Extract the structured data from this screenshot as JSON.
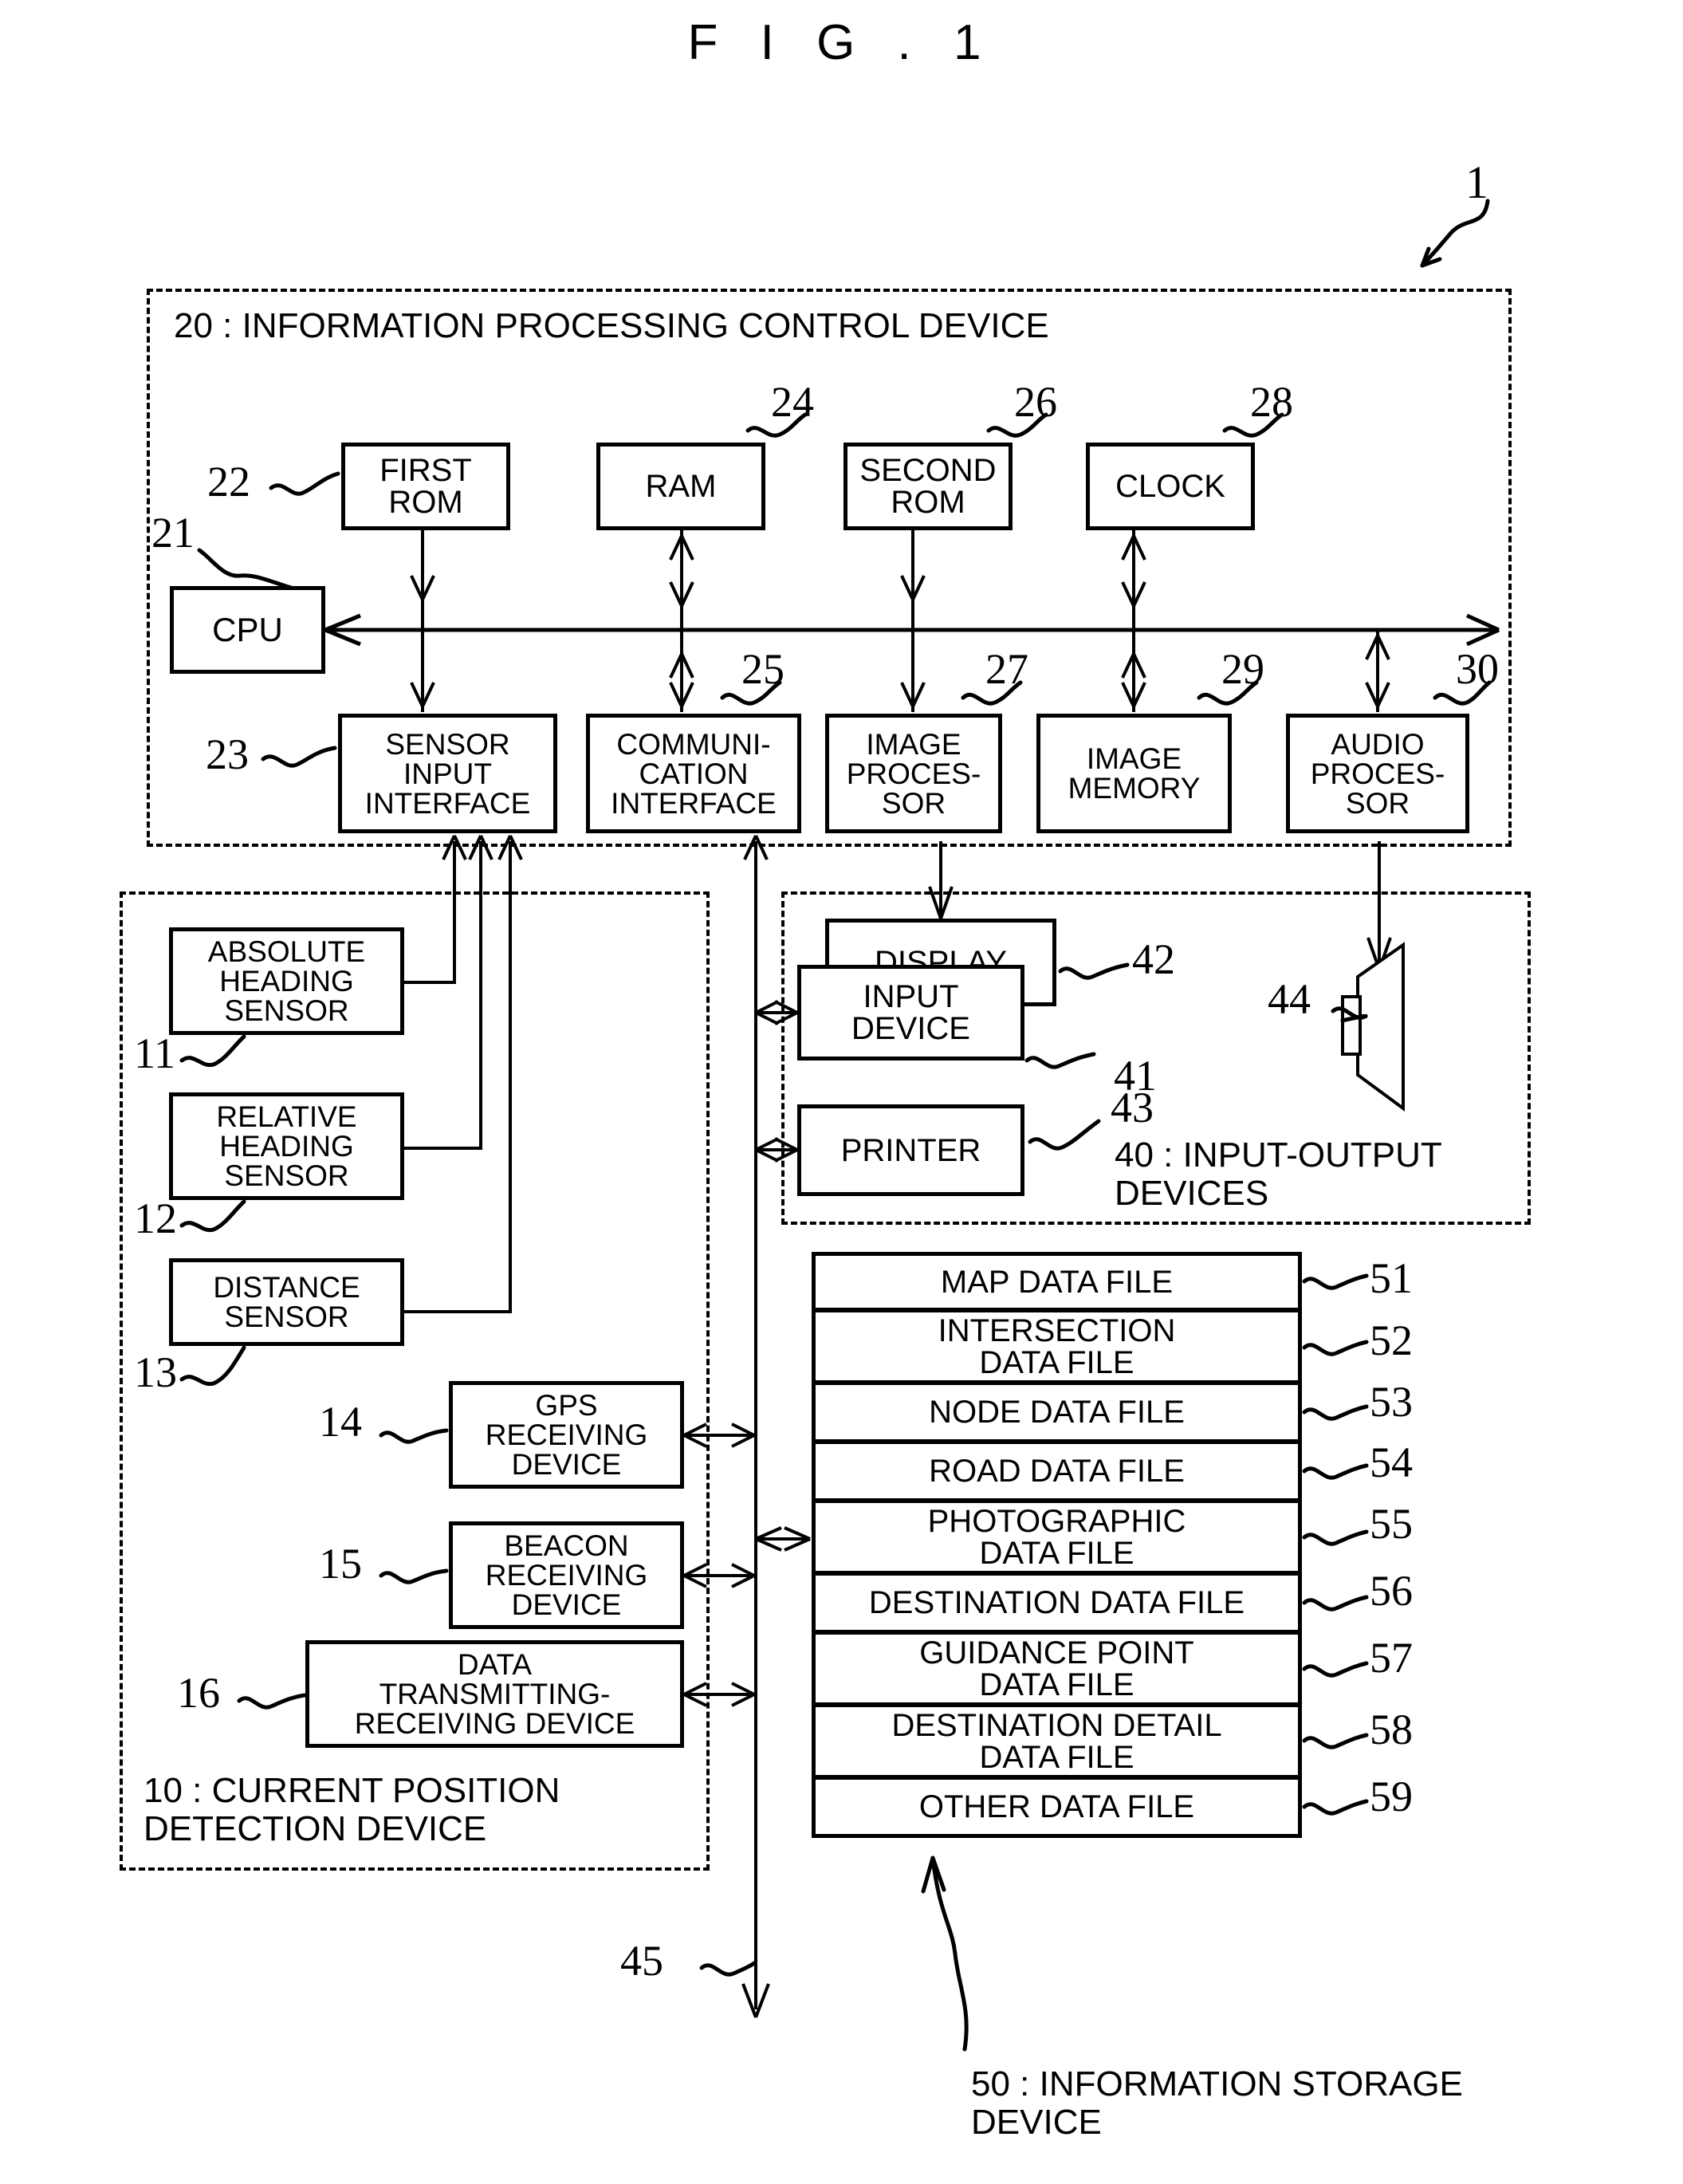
{
  "figure": {
    "title": "F I G . 1",
    "system_ref": "1"
  },
  "control_device": {
    "ref": "20",
    "label": "20 : INFORMATION PROCESSING CONTROL DEVICE",
    "cpu": {
      "ref": "21",
      "label": "CPU"
    },
    "top_row": [
      {
        "ref": "22",
        "label": "FIRST\nROM"
      },
      {
        "ref": "24",
        "label": "RAM"
      },
      {
        "ref": "26",
        "label": "SECOND\nROM"
      },
      {
        "ref": "28",
        "label": "CLOCK"
      }
    ],
    "bottom_row": [
      {
        "ref": "23",
        "label": "SENSOR\nINPUT\nINTERFACE"
      },
      {
        "ref": "25",
        "label": "COMMUNI-\nCATION\nINTERFACE"
      },
      {
        "ref": "27",
        "label": "IMAGE\nPROCES-\nSOR"
      },
      {
        "ref": "29",
        "label": "IMAGE\nMEMORY"
      },
      {
        "ref": "30",
        "label": "AUDIO\nPROCES-\nSOR"
      }
    ]
  },
  "position_device": {
    "ref": "10",
    "label": "10 : CURRENT POSITION\n DETECTION DEVICE",
    "items": [
      {
        "ref": "11",
        "label": "ABSOLUTE\nHEADING\nSENSOR"
      },
      {
        "ref": "12",
        "label": "RELATIVE\nHEADING\nSENSOR"
      },
      {
        "ref": "13",
        "label": "DISTANCE\nSENSOR"
      },
      {
        "ref": "14",
        "label": "GPS\nRECEIVING\nDEVICE"
      },
      {
        "ref": "15",
        "label": "BEACON\nRECEIVING\nDEVICE"
      },
      {
        "ref": "16",
        "label": "DATA\nTRANSMITTING-\nRECEIVING DEVICE"
      }
    ]
  },
  "io_devices": {
    "ref": "40",
    "label": "40 : INPUT-OUTPUT\n       DEVICES",
    "items": [
      {
        "ref": "42",
        "label": "DISPLAY"
      },
      {
        "ref": "41",
        "label": "INPUT\nDEVICE"
      },
      {
        "ref": "43",
        "label": "PRINTER"
      },
      {
        "ref": "44",
        "label": "",
        "icon": "speaker-icon"
      }
    ]
  },
  "storage_device": {
    "ref": "50",
    "label": "50 : INFORMATION STORAGE\n         DEVICE",
    "files": [
      {
        "ref": "51",
        "label": "MAP DATA FILE"
      },
      {
        "ref": "52",
        "label": "INTERSECTION\nDATA FILE"
      },
      {
        "ref": "53",
        "label": "NODE DATA FILE"
      },
      {
        "ref": "54",
        "label": "ROAD DATA FILE"
      },
      {
        "ref": "55",
        "label": "PHOTOGRAPHIC\nDATA FILE"
      },
      {
        "ref": "56",
        "label": "DESTINATION DATA FILE"
      },
      {
        "ref": "57",
        "label": "GUIDANCE POINT\nDATA FILE"
      },
      {
        "ref": "58",
        "label": "DESTINATION DETAIL\nDATA FILE"
      },
      {
        "ref": "59",
        "label": "OTHER DATA FILE"
      }
    ]
  },
  "bus": {
    "ref": "45"
  }
}
